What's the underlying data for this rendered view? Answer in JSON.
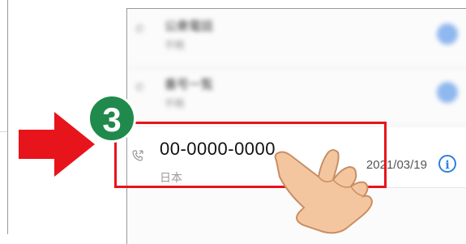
{
  "contacts": [
    {
      "number": "00-0000-0000",
      "type": "日本",
      "date": "2021/03/19"
    }
  ],
  "blurred_rows": [
    {
      "number": "公衆電話",
      "sub": "不明"
    },
    {
      "number": "番号一覧",
      "sub": "不明"
    }
  ],
  "step": {
    "number": "3"
  },
  "colors": {
    "highlight": "#e8141c",
    "step_badge": "#1f8a4c",
    "info_icon": "#2f7fe0",
    "arrow": "#e8141c",
    "hand": "#f4c6a0"
  },
  "icons": [
    "phone-call-icon",
    "info-icon",
    "pointer-hand-icon",
    "right-arrow-icon"
  ]
}
